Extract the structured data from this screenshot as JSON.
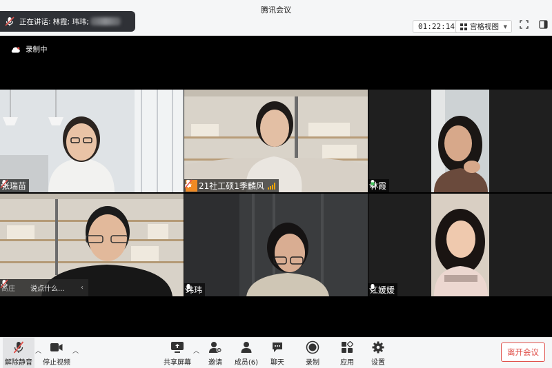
{
  "window": {
    "title": "腾讯会议"
  },
  "speaking": {
    "prefix": "正在讲话:",
    "names": "林霞; 玮玮;"
  },
  "header": {
    "timer": "01:22:14",
    "view_label": "宫格视图"
  },
  "recording": {
    "label": "录制中"
  },
  "participants": [
    {
      "name": "张瑞苗",
      "mic": "muted",
      "host": false,
      "active": false
    },
    {
      "name": "21社工硕1季麟风",
      "mic": "muted",
      "host": true,
      "active": false,
      "signal": true
    },
    {
      "name": "林霞",
      "mic": "speaking",
      "host": false,
      "active": true
    },
    {
      "name": "",
      "mic": "muted",
      "host": false,
      "active": false
    },
    {
      "name": "玮玮",
      "mic": "on",
      "host": false,
      "active": false
    },
    {
      "name": "江媛媛",
      "mic": "on",
      "host": false,
      "active": false
    }
  ],
  "chat_float": {
    "sender": "高庄",
    "placeholder": "说点什么..."
  },
  "toolbar": {
    "unmute": "解除静音",
    "stop_video": "停止视频",
    "share_screen": "共享屏幕",
    "invite": "邀请",
    "members": "成员(6)",
    "chat": "聊天",
    "record": "录制",
    "apps": "应用",
    "settings": "设置",
    "leave": "离开会议"
  },
  "colors": {
    "accent_leave": "#e0504a",
    "host_badge": "#f08a24",
    "active_border": "#3d8f49"
  }
}
